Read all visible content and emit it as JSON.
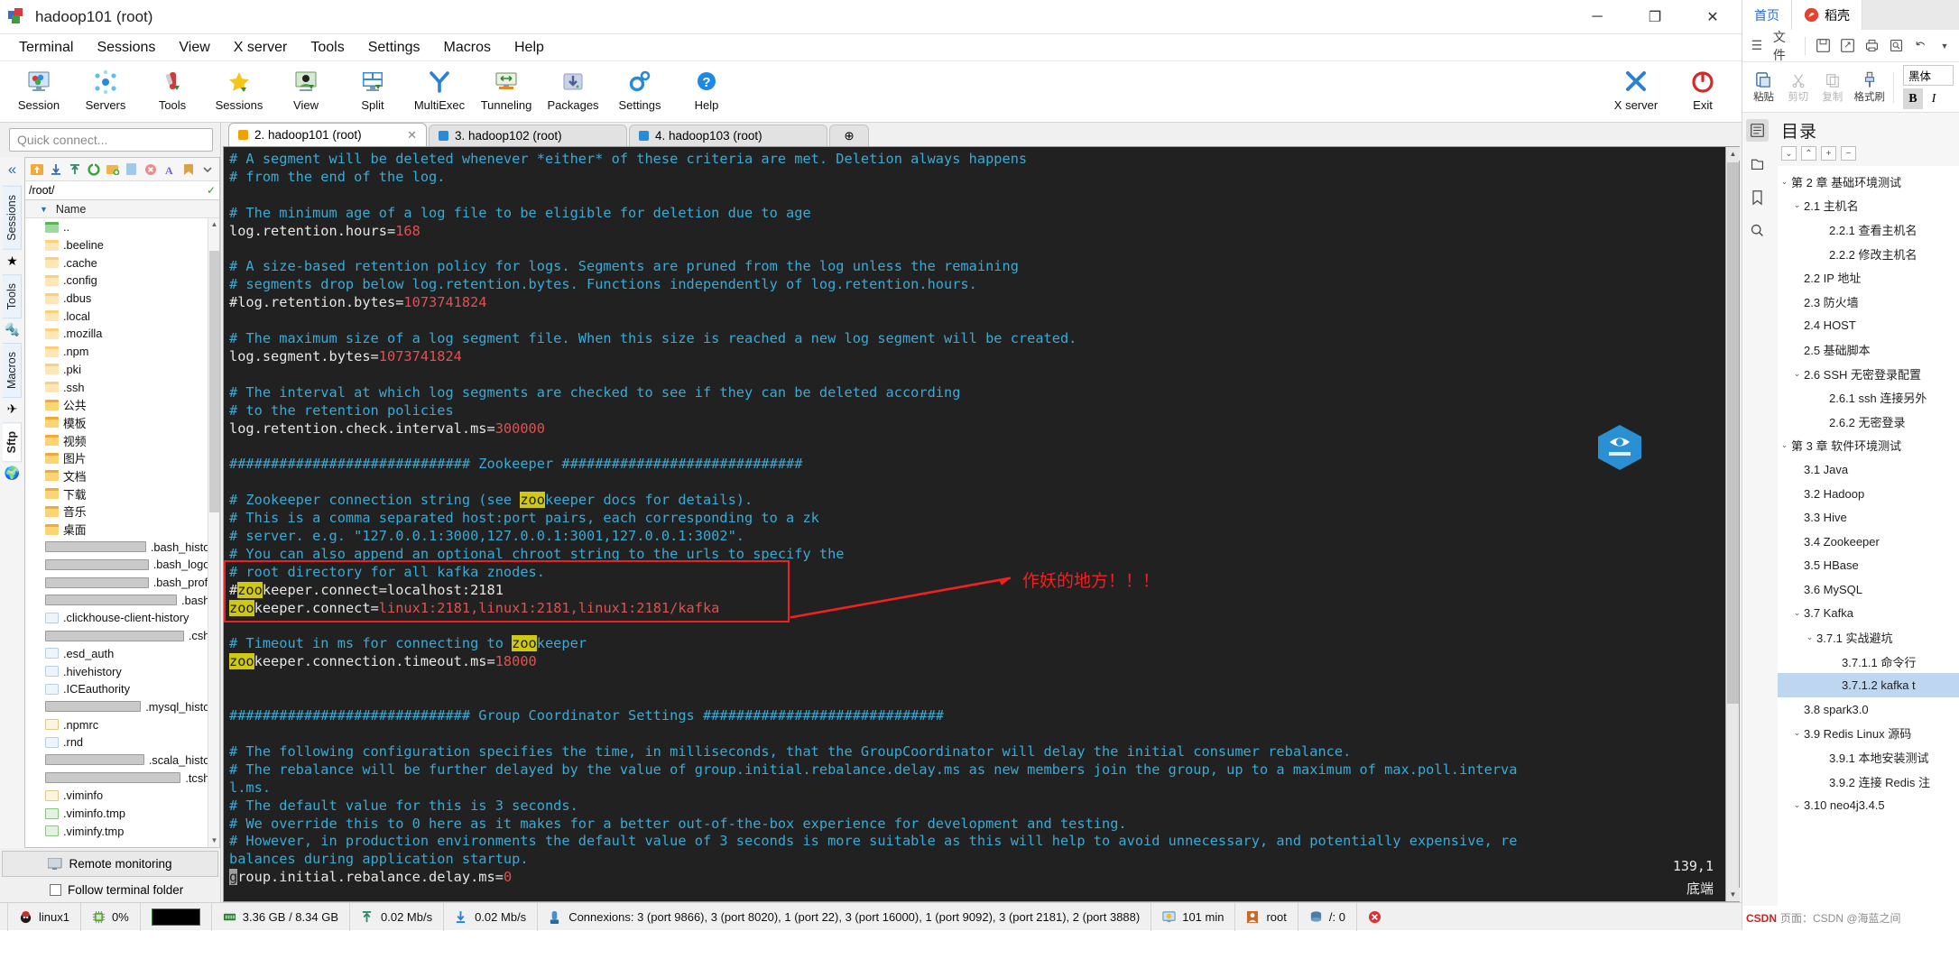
{
  "window": {
    "title": "hadoop101 (root)",
    "minimize": "─",
    "maximize": "❐",
    "close": "✕"
  },
  "menubar": [
    "Terminal",
    "Sessions",
    "View",
    "X server",
    "Tools",
    "Settings",
    "Macros",
    "Help"
  ],
  "ribbon": {
    "left": [
      {
        "label": "Session",
        "icon": "session-icon"
      },
      {
        "label": "Servers",
        "icon": "servers-icon"
      },
      {
        "label": "Tools",
        "icon": "tools-icon"
      },
      {
        "label": "Sessions",
        "icon": "sessions-star-icon"
      },
      {
        "label": "View",
        "icon": "view-icon"
      },
      {
        "label": "Split",
        "icon": "split-icon"
      },
      {
        "label": "MultiExec",
        "icon": "multiexec-icon"
      },
      {
        "label": "Tunneling",
        "icon": "tunneling-icon"
      },
      {
        "label": "Packages",
        "icon": "packages-icon"
      },
      {
        "label": "Settings",
        "icon": "settings-gear-icon"
      },
      {
        "label": "Help",
        "icon": "help-icon"
      }
    ],
    "right": [
      {
        "label": "X server",
        "icon": "xserver-icon"
      },
      {
        "label": "Exit",
        "icon": "power-exit-icon"
      }
    ]
  },
  "sidebar": {
    "quick_connect_placeholder": "Quick connect...",
    "collapse_icon": "«",
    "vtabs": [
      {
        "label": "Sessions",
        "icon": "star-icon"
      },
      {
        "label": "Tools",
        "icon": "knife-icon"
      },
      {
        "label": "Macros",
        "icon": "paperplane-icon"
      },
      {
        "label": "Sftp",
        "icon": "globe-icon",
        "selected": true
      }
    ],
    "sftp_tools": [
      "up-dir-icon",
      "download-icon",
      "upload-icon",
      "refresh-icon",
      "new-folder-icon",
      "new-file-icon",
      "delete-icon",
      "text-mode-icon",
      "bookmark-icon",
      "chevron-down-icon"
    ],
    "path": "/root/",
    "column_header": "Name",
    "files": [
      {
        "name": "..",
        "type": "folder-up"
      },
      {
        "name": ".beeline",
        "type": "folder-light"
      },
      {
        "name": ".cache",
        "type": "folder-light"
      },
      {
        "name": ".config",
        "type": "folder-light"
      },
      {
        "name": ".dbus",
        "type": "folder-light"
      },
      {
        "name": ".local",
        "type": "folder-light"
      },
      {
        "name": ".mozilla",
        "type": "folder-light"
      },
      {
        "name": ".npm",
        "type": "folder-light"
      },
      {
        "name": ".pki",
        "type": "folder-light"
      },
      {
        "name": ".ssh",
        "type": "folder-light"
      },
      {
        "name": "公共",
        "type": "folder"
      },
      {
        "name": "模板",
        "type": "folder"
      },
      {
        "name": "视频",
        "type": "folder"
      },
      {
        "name": "图片",
        "type": "folder"
      },
      {
        "name": "文档",
        "type": "folder"
      },
      {
        "name": "下载",
        "type": "folder"
      },
      {
        "name": "音乐",
        "type": "folder"
      },
      {
        "name": "桌面",
        "type": "folder"
      },
      {
        "name": ".bash_history",
        "type": "term"
      },
      {
        "name": ".bash_logout",
        "type": "term"
      },
      {
        "name": ".bash_profile",
        "type": "term"
      },
      {
        "name": ".bashrc",
        "type": "term"
      },
      {
        "name": ".clickhouse-client-history",
        "type": "doc"
      },
      {
        "name": ".cshrc",
        "type": "term"
      },
      {
        "name": ".esd_auth",
        "type": "doc"
      },
      {
        "name": ".hivehistory",
        "type": "doc"
      },
      {
        "name": ".ICEauthority",
        "type": "doc"
      },
      {
        "name": ".mysql_history",
        "type": "term"
      },
      {
        "name": ".npmrc",
        "type": "edit"
      },
      {
        "name": ".rnd",
        "type": "doc"
      },
      {
        "name": ".scala_history",
        "type": "term"
      },
      {
        "name": ".tcshrc",
        "type": "term"
      },
      {
        "name": ".viminfo",
        "type": "edit"
      },
      {
        "name": ".viminfo.tmp",
        "type": "recycle"
      },
      {
        "name": ".viminfy.tmp",
        "type": "recycle"
      }
    ],
    "remote_monitoring": "Remote monitoring",
    "follow_terminal_folder": "Follow terminal folder"
  },
  "tabs": [
    {
      "label": "2. hadoop101 (root)",
      "color": "#f0a000",
      "active": true,
      "close": "✕"
    },
    {
      "label": "3. hadoop102 (root)",
      "color": "#2b8ad6",
      "active": false,
      "close": ""
    },
    {
      "label": "4. hadoop103 (root)",
      "color": "#2b8ad6",
      "active": false,
      "close": ""
    },
    {
      "label": "⊕",
      "color": "",
      "active": false,
      "close": ""
    }
  ],
  "terminal": {
    "lines": [
      [
        {
          "t": "c",
          "s": "# A segment will be deleted whenever *either* of these criteria are met. Deletion always happens"
        }
      ],
      [
        {
          "t": "c",
          "s": "# from the end of the log."
        }
      ],
      [
        {
          "t": "c",
          "s": ""
        }
      ],
      [
        {
          "t": "c",
          "s": "# The minimum age of a log file to be eligible for deletion due to age"
        }
      ],
      [
        {
          "t": "k",
          "s": "log.retention.hours="
        },
        {
          "t": "v",
          "s": "168"
        }
      ],
      [
        {
          "t": "c",
          "s": ""
        }
      ],
      [
        {
          "t": "c",
          "s": "# A size-based retention policy for logs. Segments are pruned from the log unless the remaining"
        }
      ],
      [
        {
          "t": "c",
          "s": "# segments drop below log.retention.bytes. Functions independently of log.retention.hours."
        }
      ],
      [
        {
          "t": "k",
          "s": "#log.retention.bytes="
        },
        {
          "t": "v",
          "s": "1073741824"
        }
      ],
      [
        {
          "t": "c",
          "s": ""
        }
      ],
      [
        {
          "t": "c",
          "s": "# The maximum size of a log segment file. When this size is reached a new log segment will be created."
        }
      ],
      [
        {
          "t": "k",
          "s": "log.segment.bytes="
        },
        {
          "t": "v",
          "s": "1073741824"
        }
      ],
      [
        {
          "t": "c",
          "s": ""
        }
      ],
      [
        {
          "t": "c",
          "s": "# The interval at which log segments are checked to see if they can be deleted according"
        }
      ],
      [
        {
          "t": "c",
          "s": "# to the retention policies"
        }
      ],
      [
        {
          "t": "k",
          "s": "log.retention.check.interval.ms="
        },
        {
          "t": "v",
          "s": "300000"
        }
      ],
      [
        {
          "t": "c",
          "s": ""
        }
      ],
      [
        {
          "t": "c",
          "s": "############################# Zookeeper #############################"
        }
      ],
      [
        {
          "t": "c",
          "s": ""
        }
      ],
      [
        {
          "t": "c",
          "s": "# Zookeeper connection string (see "
        },
        {
          "t": "hl",
          "s": "zoo"
        },
        {
          "t": "c",
          "s": "keeper docs for details)."
        }
      ],
      [
        {
          "t": "c",
          "s": "# This is a comma separated host:port pairs, each corresponding to a zk"
        }
      ],
      [
        {
          "t": "c",
          "s": "# server. e.g. \"127.0.0.1:3000,127.0.0.1:3001,127.0.0.1:3002\"."
        }
      ],
      [
        {
          "t": "c",
          "s": "# You can also append an optional chroot string to the urls to specify the"
        }
      ],
      [
        {
          "t": "c",
          "s": "# root directory for all kafka znodes."
        }
      ],
      [
        {
          "t": "k",
          "s": "#"
        },
        {
          "t": "hl",
          "s": "zoo"
        },
        {
          "t": "k",
          "s": "keeper.connect=localhost:2181"
        }
      ],
      [
        {
          "t": "hl",
          "s": "zoo"
        },
        {
          "t": "k",
          "s": "keeper.connect="
        },
        {
          "t": "v",
          "s": "linux1:2181,linux1:2181,linux1:2181/kafka"
        }
      ],
      [
        {
          "t": "c",
          "s": ""
        }
      ],
      [
        {
          "t": "c",
          "s": "# Timeout in ms for connecting to "
        },
        {
          "t": "hl",
          "s": "zoo"
        },
        {
          "t": "c",
          "s": "keeper"
        }
      ],
      [
        {
          "t": "hl",
          "s": "zoo"
        },
        {
          "t": "k",
          "s": "keeper.connection.timeout.ms="
        },
        {
          "t": "v",
          "s": "18000"
        }
      ],
      [
        {
          "t": "c",
          "s": ""
        }
      ],
      [
        {
          "t": "c",
          "s": ""
        }
      ],
      [
        {
          "t": "c",
          "s": "############################# Group Coordinator Settings #############################"
        }
      ],
      [
        {
          "t": "c",
          "s": ""
        }
      ],
      [
        {
          "t": "c",
          "s": "# The following configuration specifies the time, in milliseconds, that the GroupCoordinator will delay the initial consumer rebalance."
        }
      ],
      [
        {
          "t": "c",
          "s": "# The rebalance will be further delayed by the value of group.initial.rebalance.delay.ms as new members join the group, up to a maximum of max.poll.interva"
        }
      ],
      [
        {
          "t": "c",
          "s": "l.ms."
        }
      ],
      [
        {
          "t": "c",
          "s": "# The default value for this is 3 seconds."
        }
      ],
      [
        {
          "t": "c",
          "s": "# We override this to 0 here as it makes for a better out-of-the-box experience for development and testing."
        }
      ],
      [
        {
          "t": "c",
          "s": "# However, in production environments the default value of 3 seconds is more suitable as this will help to avoid unnecessary, and potentially expensive, re"
        }
      ],
      [
        {
          "t": "c",
          "s": "balances during application startup."
        }
      ],
      [
        {
          "t": "curs",
          "s": "g"
        },
        {
          "t": "k",
          "s": "roup.initial.rebalance.delay.ms="
        },
        {
          "t": "v",
          "s": "0"
        }
      ]
    ],
    "annotation": "作妖的地方！！！",
    "cursor_position": "139,1",
    "bottom_label": "底端"
  },
  "statusbar": {
    "items": [
      {
        "label": "linux1",
        "icon": "linux-hat-icon"
      },
      {
        "label": "0%",
        "icon": "cpu-icon"
      },
      {
        "label": "",
        "icon": "cpu-graph-icon"
      },
      {
        "label": "3.36 GB / 8.34 GB",
        "icon": "memory-icon"
      },
      {
        "label": "0.02 Mb/s",
        "icon": "upload-arrow-icon"
      },
      {
        "label": "0.02 Mb/s",
        "icon": "download-arrow-icon"
      },
      {
        "label": "Connexions: 3 (port 9866), 3 (port 8020), 1 (port 22), 3 (port 16000), 1 (port 9092), 3 (port 2181), 2 (port 3888)",
        "icon": "network-icon"
      },
      {
        "label": "101 min",
        "icon": "uptime-monitor-icon"
      },
      {
        "label": "root",
        "icon": "user-icon"
      },
      {
        "label": "/: 0",
        "icon": "disk-icon"
      }
    ],
    "close_icon": "✕"
  },
  "wps": {
    "tabs": [
      {
        "label": "首页",
        "icon": "home-tab"
      },
      {
        "label": "稻壳",
        "icon": "daoke-icon"
      }
    ],
    "menu": {
      "file_label": "文件",
      "icons": [
        "hamburger-icon",
        "save-icon",
        "save-as-icon",
        "print-icon",
        "print-preview-icon",
        "undo-icon",
        "chevron-down-icon"
      ]
    },
    "ribbon": {
      "paste": "粘贴",
      "cut": "剪切",
      "copy": "复制",
      "format_painter": "格式刷",
      "font_name": "黑体",
      "bold": "B",
      "italic": "I"
    },
    "rail": [
      "outline-icon",
      "sections-icon",
      "bookmark-icon",
      "search-icon"
    ],
    "outline_title": "目录",
    "outline_buttons": [
      "⌄",
      "⌃",
      "+",
      "−"
    ],
    "toc": [
      {
        "text": "第 2 章  基础环境测试",
        "indent": 0,
        "twisty": "⌄"
      },
      {
        "text": "2.1  主机名",
        "indent": 1,
        "twisty": "⌄"
      },
      {
        "text": "2.2.1  查看主机名",
        "indent": 3,
        "twisty": ""
      },
      {
        "text": "2.2.2  修改主机名",
        "indent": 3,
        "twisty": ""
      },
      {
        "text": "2.2 IP 地址",
        "indent": 1,
        "twisty": ""
      },
      {
        "text": "2.3  防火墙",
        "indent": 1,
        "twisty": ""
      },
      {
        "text": "2.4 HOST",
        "indent": 1,
        "twisty": ""
      },
      {
        "text": "2.5  基础脚本",
        "indent": 1,
        "twisty": ""
      },
      {
        "text": "2.6 SSH 无密登录配置",
        "indent": 1,
        "twisty": "⌄"
      },
      {
        "text": "2.6.1 ssh 连接另外",
        "indent": 3,
        "twisty": ""
      },
      {
        "text": "2.6.2  无密登录",
        "indent": 3,
        "twisty": ""
      },
      {
        "text": "第 3 章  软件环境测试",
        "indent": 0,
        "twisty": "⌄"
      },
      {
        "text": "3.1 Java",
        "indent": 1,
        "twisty": ""
      },
      {
        "text": "3.2 Hadoop",
        "indent": 1,
        "twisty": ""
      },
      {
        "text": "3.3 Hive",
        "indent": 1,
        "twisty": ""
      },
      {
        "text": "3.4 Zookeeper",
        "indent": 1,
        "twisty": ""
      },
      {
        "text": "3.5 HBase",
        "indent": 1,
        "twisty": ""
      },
      {
        "text": "3.6 MySQL",
        "indent": 1,
        "twisty": ""
      },
      {
        "text": "3.7 Kafka",
        "indent": 1,
        "twisty": "⌄"
      },
      {
        "text": "3.7.1 实战避坑",
        "indent": 2,
        "twisty": "⌄"
      },
      {
        "text": "3.7.1.1  命令行",
        "indent": 4,
        "twisty": ""
      },
      {
        "text": "3.7.1.2 kafka t",
        "indent": 4,
        "twisty": "",
        "selected": true
      },
      {
        "text": "3.8 spark3.0",
        "indent": 1,
        "twisty": ""
      },
      {
        "text": "3.9 Redis Linux  源码",
        "indent": 1,
        "twisty": "⌄"
      },
      {
        "text": "3.9.1  本地安装测试",
        "indent": 3,
        "twisty": ""
      },
      {
        "text": "3.9.2 连接 Redis 注",
        "indent": 3,
        "twisty": ""
      },
      {
        "text": "3.10 neo4j3.4.5",
        "indent": 1,
        "twisty": "⌄"
      }
    ],
    "watermark": "页面：CSDN @海蓝之间"
  },
  "colors": {
    "accent": "#2b6cd4",
    "terminal_bg": "#212121",
    "terminal_comment": "#3aaad6",
    "terminal_value": "#e05252",
    "highlight": "#cfc914",
    "annotation_red": "#f22020"
  }
}
